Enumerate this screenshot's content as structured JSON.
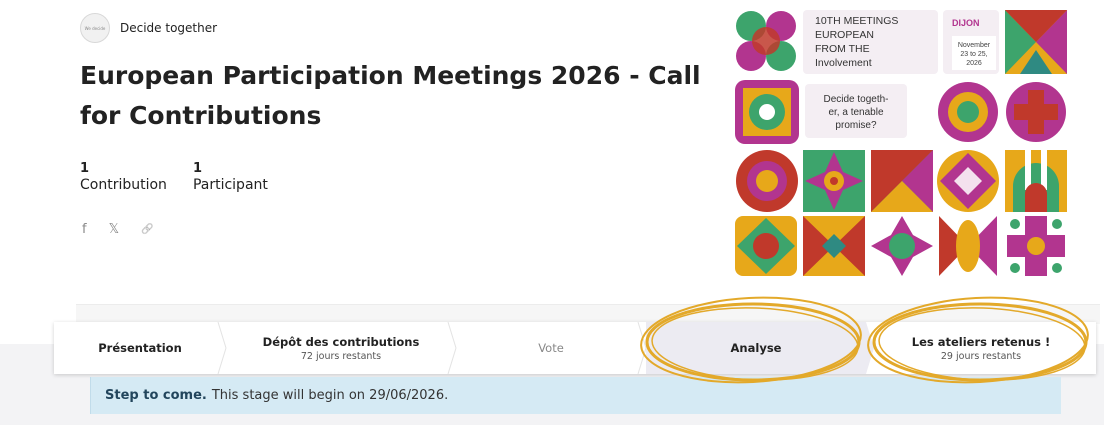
{
  "org": {
    "name": "Decide together",
    "logo_text": "We decide"
  },
  "process": {
    "title": "European Participation Meetings 2026 - Call for Contributions"
  },
  "stats": [
    {
      "number": "1",
      "label": "Contribution"
    },
    {
      "number": "1",
      "label": "Participant"
    }
  ],
  "share": {
    "facebook": "f",
    "x": "𝕏",
    "link": "🔗"
  },
  "poster": {
    "headline_lines": [
      "10TH MEETINGS",
      "EUROPEAN",
      "FROM THE",
      "Involvement"
    ],
    "city": "DIJON",
    "date_lines": [
      "November",
      "23 to 25,",
      "2026"
    ],
    "tagline_lines": [
      "Decide togeth-",
      "er, a tenable",
      "promise?"
    ]
  },
  "steps": [
    {
      "label": "Présentation",
      "sub": ""
    },
    {
      "label": "Dépôt des contributions",
      "sub": "72 jours restants"
    },
    {
      "label": "Vote",
      "sub": ""
    },
    {
      "label": "Analyse",
      "sub": ""
    },
    {
      "label": "Les ateliers retenus !",
      "sub": "29 jours restants"
    }
  ],
  "notice": {
    "strong": "Step to come.",
    "text": "This stage will begin on 29/06/2026."
  },
  "colors": {
    "magenta": "#b2358f",
    "green": "#3da46c",
    "yellow": "#e7a81a",
    "red": "#c0392b",
    "teal": "#2f8a82",
    "highlight_circle": "#e3a92a",
    "notice_bg": "#d5eaf4",
    "active_tab_bg": "#ecebf2"
  }
}
